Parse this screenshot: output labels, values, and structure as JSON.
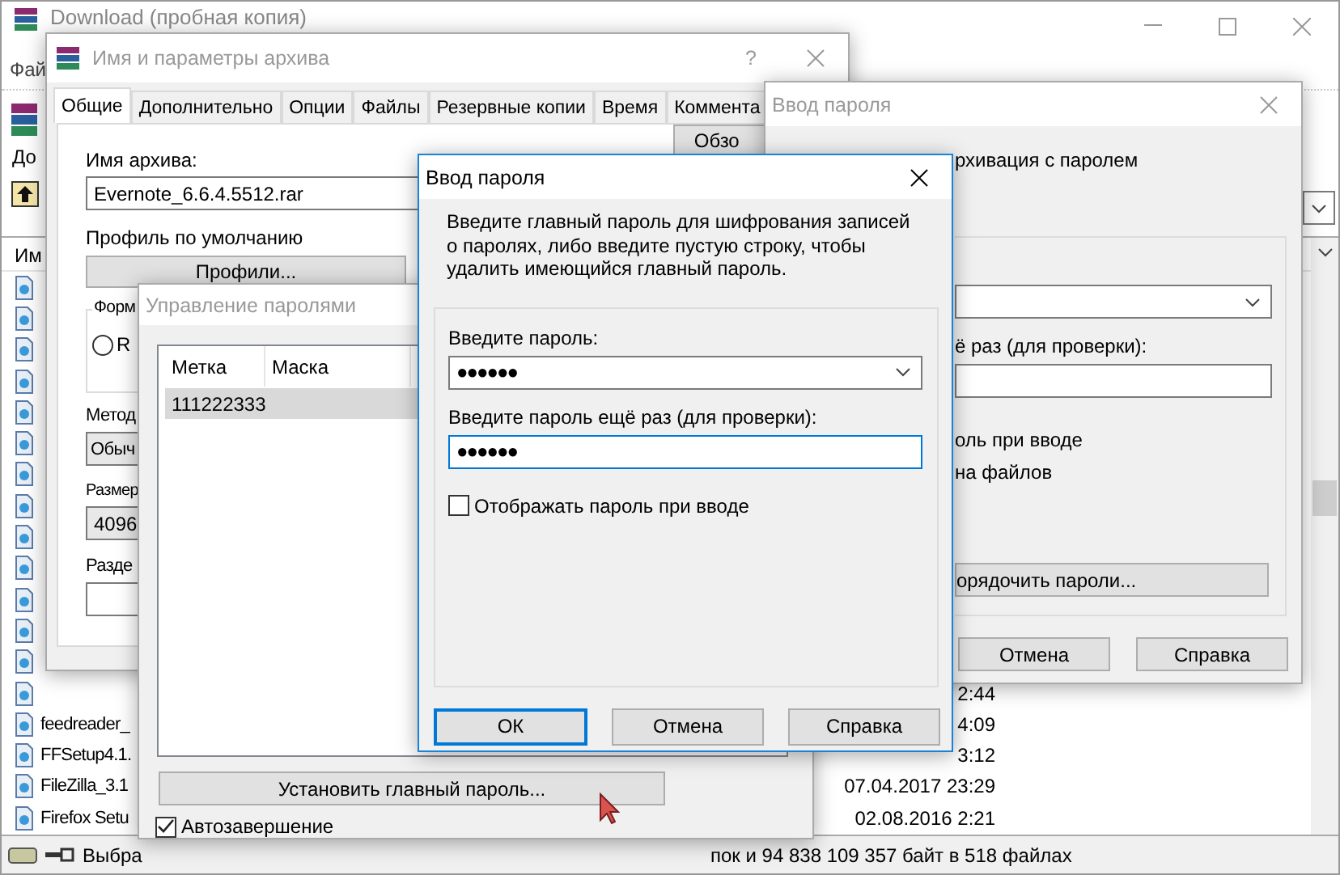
{
  "main_window": {
    "title": "Download (пробная копия)",
    "menu": [
      {
        "label": "Фай"
      }
    ],
    "toolbar_button": "До",
    "list_header": "Им",
    "rows": [
      {},
      {},
      {},
      {},
      {},
      {},
      {},
      {},
      {},
      {},
      {},
      {},
      {},
      {
        "date": "2:44"
      },
      {
        "name": "feedreader_",
        "date": "4:09"
      },
      {
        "name": "FFSetup4.1.",
        "date": "3:12"
      },
      {
        "name": "FileZilla_3.1",
        "date": "07.04.2017 23:29"
      },
      {
        "name": "Firefox Setu",
        "date": "02.08.2016 2:21"
      }
    ],
    "status_left": "Выбра",
    "status_right": "пок и 94 838 109 357 байт в 518 файлах"
  },
  "archive_dialog": {
    "title": "Имя и параметры архива",
    "help": "?",
    "tabs": [
      {
        "label": "Общие",
        "selected": true
      },
      {
        "label": "Дополнительно",
        "selected": false
      },
      {
        "label": "Опции",
        "selected": false
      },
      {
        "label": "Файлы",
        "selected": false
      },
      {
        "label": "Резервные копии",
        "selected": false
      },
      {
        "label": "Время",
        "selected": false
      },
      {
        "label": "Коммента",
        "selected": false
      }
    ],
    "archive_name_label": "Имя архива:",
    "archive_name": "Evernote_6.6.4.5512.rar",
    "browse_button": "Обзо",
    "profile_label": "Профиль по умолчанию",
    "profiles_button": "Профили...",
    "format_group": "Форм",
    "format_option": {
      "label": "R",
      "selected": false
    },
    "method_label": "Метод",
    "method_value": "Обыч",
    "size_label": "Размер",
    "size_value": "4096",
    "split_label": "Разде"
  },
  "password_dialog_back": {
    "title": "Ввод пароля",
    "heading": "рхивация с паролем",
    "confirm_label": "ё раз (для проверки):",
    "show_option": "оль при вводе",
    "encrypt_option": "на файлов",
    "organize_button": "орядочить пароли...",
    "buttons": [
      "Отмена",
      "Справка"
    ]
  },
  "password_manager": {
    "title": "Управление паролями",
    "columns": [
      "Метка",
      "Маска"
    ],
    "rows": [
      {
        "label": "111222333",
        "selected": true
      }
    ],
    "set_master_button": "Установить главный пароль...",
    "autocomplete": {
      "label": "Автозавершение",
      "checked": true
    }
  },
  "master_password_dialog": {
    "title": "Ввод пароля",
    "message": "Введите главный пароль для шифрования записей о паролях, либо введите пустую строку, чтобы удалить имеющийся главный пароль.",
    "password_label": "Введите пароль:",
    "password": "●●●●●●",
    "confirm_label": "Введите пароль ещё раз (для проверки):",
    "confirm": "●●●●●●",
    "show_password": {
      "label": "Отображать пароль при вводе",
      "checked": false
    },
    "buttons": [
      {
        "label": "ОК",
        "default": true
      },
      {
        "label": "Отмена",
        "default": false
      },
      {
        "label": "Справка",
        "default": false
      }
    ]
  }
}
